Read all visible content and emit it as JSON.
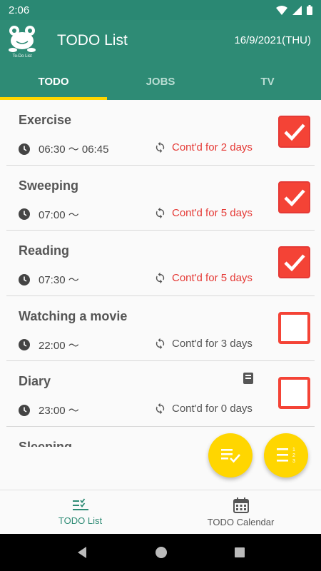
{
  "status_bar": {
    "time": "2:06"
  },
  "app_bar": {
    "title": "TODO List",
    "date": "16/9/2021(THU)",
    "logo_text": "To-Do List"
  },
  "tabs": [
    {
      "label": "TODO",
      "active": true
    },
    {
      "label": "JOBS",
      "active": false
    },
    {
      "label": "TV",
      "active": false
    }
  ],
  "todos": [
    {
      "title": "Exercise",
      "time": "06:30 〜 06:45",
      "streak": "Cont'd for 2 days",
      "done": true
    },
    {
      "title": "Sweeping",
      "time": "07:00 〜",
      "streak": "Cont'd for 5 days",
      "done": true
    },
    {
      "title": "Reading",
      "time": "07:30 〜",
      "streak": "Cont'd for 5 days",
      "done": true
    },
    {
      "title": "Watching a movie",
      "time": "22:00 〜",
      "streak": "Cont'd for 3 days",
      "done": false
    },
    {
      "title": "Diary",
      "time": "23:00 〜",
      "streak": "Cont'd for 0 days",
      "done": false,
      "has_note": true
    },
    {
      "title": "Sleeping",
      "time": "",
      "streak": "",
      "done": false
    }
  ],
  "bottom_nav": {
    "list_label": "TODO List",
    "calendar_label": "TODO Calendar"
  },
  "colors": {
    "primary": "#2e8b75",
    "accent": "#ffd600",
    "check": "#f44336",
    "streak_active": "#e53935"
  }
}
